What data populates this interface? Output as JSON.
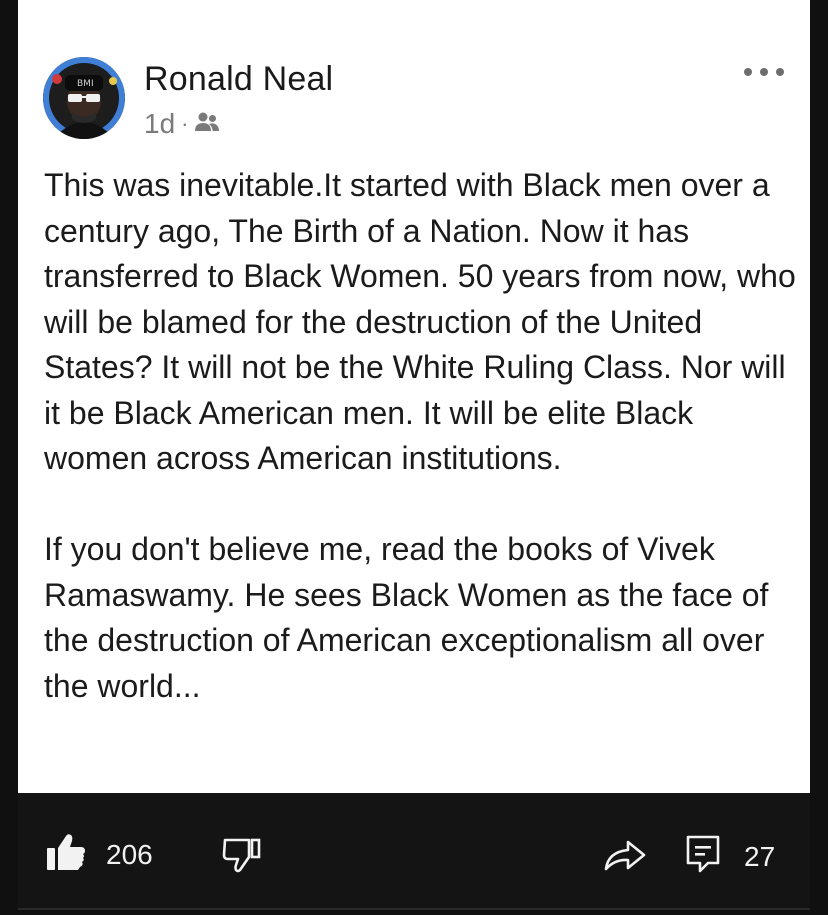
{
  "post": {
    "author": "Ronald Neal",
    "age": "1d",
    "separator": "·",
    "audience_icon": "friends-icon",
    "more_icon": "more-options-icon",
    "paragraphs": [
      "This was inevitable.It started with Black men over a century ago, The Birth of a Nation. Now it has transferred to Black Women. 50 years from now, who will be blamed for the destruction of the United States? It will not be the White Ruling Class. Nor will it be Black American men. It will be elite Black women across American institutions.",
      "If you don't believe me, read the books of Vivek Ramaswamy. He sees Black Women as the face of the destruction of American exceptionalism all over the world..."
    ]
  },
  "actions": {
    "like_icon": "thumbs-up-icon",
    "like_count": "206",
    "dislike_icon": "thumbs-down-icon",
    "share_icon": "share-icon",
    "comment_icon": "comment-icon",
    "comment_count": "27"
  },
  "colors": {
    "card_background": "#ffffff",
    "page_background": "#101010",
    "action_bar_background": "#141414",
    "body_text": "#1b1b1b",
    "meta_text": "#7a7a7a",
    "avatar_ring": "#3f7fd6"
  }
}
